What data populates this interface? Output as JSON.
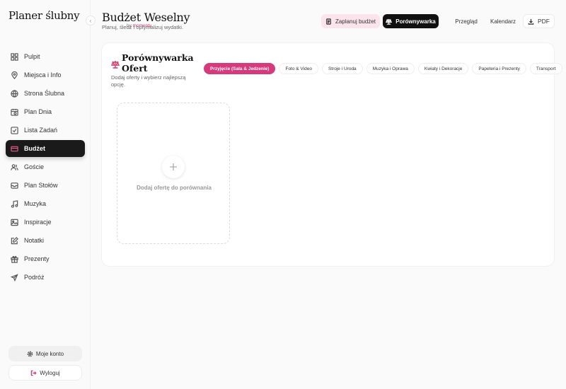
{
  "brand": {
    "title": "Planer ślubny",
    "by": "by",
    "company": "momenty"
  },
  "sidebar": {
    "items": [
      {
        "label": "Pulpit",
        "icon": "grid-icon"
      },
      {
        "label": "Miejsca i Info",
        "icon": "map-pin-icon"
      },
      {
        "label": "Strona Ślubna",
        "icon": "globe-icon"
      },
      {
        "label": "Plan Dnia",
        "icon": "calendar-clock-icon"
      },
      {
        "label": "Lista Zadań",
        "icon": "checkbox-icon"
      },
      {
        "label": "Budżet",
        "icon": "credit-card-icon",
        "active": true
      },
      {
        "label": "Goście",
        "icon": "users-icon"
      },
      {
        "label": "Plan Stołów",
        "icon": "table-icon"
      },
      {
        "label": "Muzyka",
        "icon": "music-icon"
      },
      {
        "label": "Inspiracje",
        "icon": "image-icon"
      },
      {
        "label": "Notatki",
        "icon": "note-icon"
      },
      {
        "label": "Prezenty",
        "icon": "gift-icon"
      },
      {
        "label": "Podróż",
        "icon": "plane-icon"
      }
    ],
    "account_label": "Moje konto",
    "logout_label": "Wyloguj"
  },
  "header": {
    "title": "Budżet Weselny",
    "subtitle": "Planuj, śledź i optymalizuj wydatki.",
    "plan_label": "Zaplanuj budżet",
    "compare_label": "Porównywarka",
    "overview_label": "Przegląd",
    "calendar_label": "Kalendarz",
    "pdf_label": "PDF"
  },
  "card": {
    "title": "Porównywarka Ofert",
    "description": "Dodaj oferty i wybierz najlepszą opcję.",
    "tabs": [
      {
        "label": "Przyjęcie (Sala & Jedzenie)",
        "active": true
      },
      {
        "label": "Foto & Video"
      },
      {
        "label": "Stroje i Uroda"
      },
      {
        "label": "Muzyka i Oprawa"
      },
      {
        "label": "Kwiaty i Dekoracje"
      },
      {
        "label": "Papeteria i Prezenty"
      },
      {
        "label": "Transport"
      }
    ],
    "add_offer_label": "Dodaj ofertę do porównania"
  },
  "colors": {
    "accent": "#d63a7c",
    "accent_soft": "#fce4ec",
    "dark": "#111111"
  }
}
